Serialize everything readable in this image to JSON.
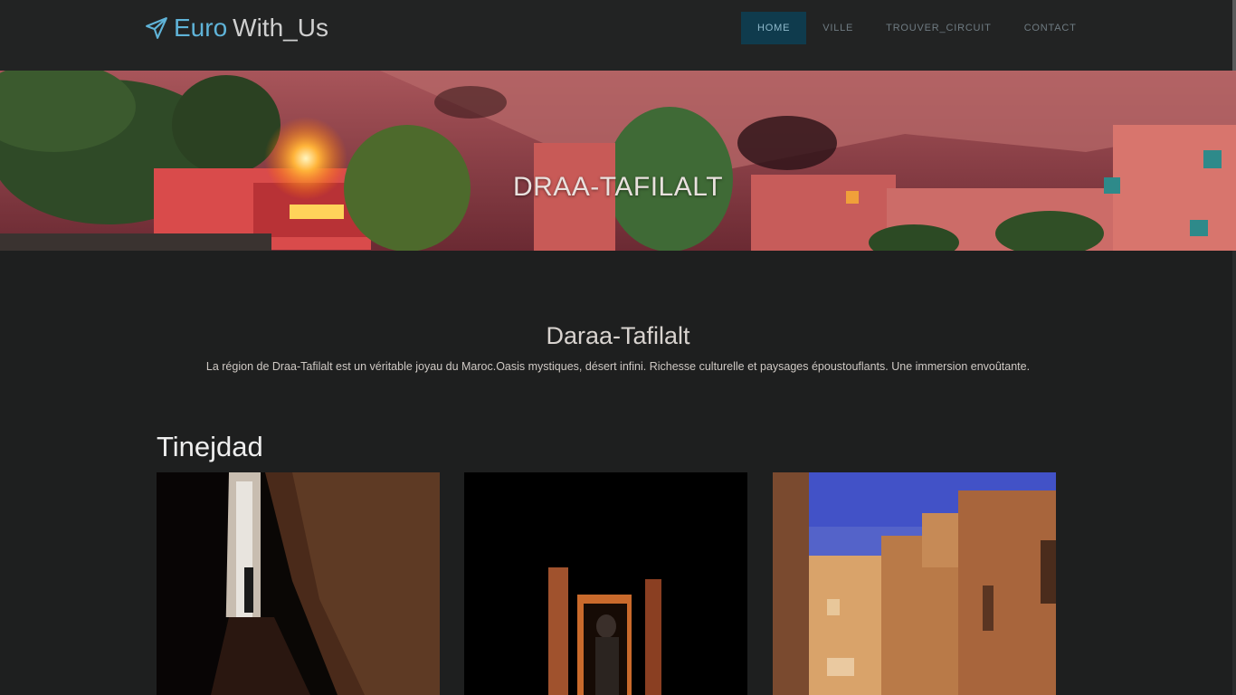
{
  "brand": {
    "part1": "Euro",
    "part2": "With_Us",
    "icon": "paper-plane-icon"
  },
  "nav": {
    "items": [
      {
        "label": "HOME",
        "active": true
      },
      {
        "label": "VILLE",
        "active": false
      },
      {
        "label": "TROUVER_CIRCUIT",
        "active": false
      },
      {
        "label": "CONTACT",
        "active": false
      }
    ]
  },
  "hero": {
    "title": "DRAA-TAFILALT"
  },
  "region": {
    "title": "Daraa-Tafilalt",
    "description": "La région de Draa-Tafilalt est un véritable joyau du Maroc.Oasis mystiques, désert infini. Richesse culturelle et paysages époustouflants. Une immersion envoûtante."
  },
  "city": {
    "title": "Tinejdad"
  },
  "colors": {
    "accent": "#5fb3d8",
    "nav_active_bg": "#0f3b4d",
    "background": "#1e1f1f"
  }
}
